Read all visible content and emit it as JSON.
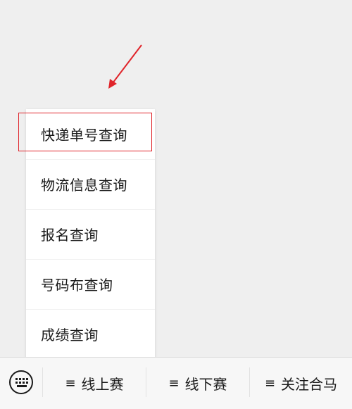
{
  "menu": {
    "items": [
      {
        "label": "快递单号查询"
      },
      {
        "label": "物流信息查询"
      },
      {
        "label": "报名查询"
      },
      {
        "label": "号码布查询"
      },
      {
        "label": "成绩查询"
      }
    ]
  },
  "bottom_bar": {
    "keyboard_icon": "keyboard-icon",
    "tabs": [
      {
        "icon": "≡",
        "label": "线上赛"
      },
      {
        "icon": "≡",
        "label": "线下赛"
      },
      {
        "icon": "≡",
        "label": "关注合马"
      }
    ]
  },
  "annotation": {
    "color": "#e0242a"
  }
}
